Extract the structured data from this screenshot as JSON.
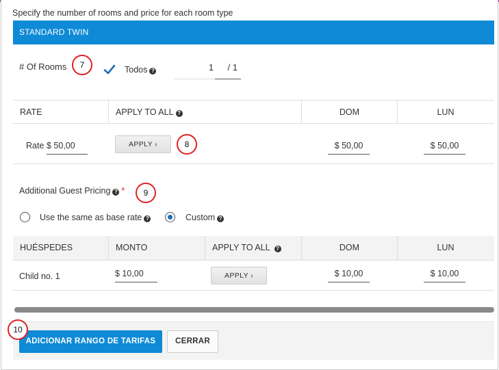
{
  "instructions": "Specify the number of rooms and price for each room type",
  "room_type": {
    "name": "STANDARD TWIN"
  },
  "rooms": {
    "label": "# Of Rooms",
    "todos_label": "Todos",
    "todos_checked": true,
    "value": "1",
    "total": "/ 1"
  },
  "rate_table": {
    "headers": [
      "RATE",
      "APPLY TO ALL",
      "DOM",
      "LUN"
    ],
    "row": {
      "label": "Rate",
      "value": "$ 50,00",
      "apply_label": "APPLY",
      "dom": "$ 50,00",
      "lun": "$ 50,00"
    }
  },
  "additional_guest": {
    "label": "Additional Guest Pricing",
    "required_mark": "*",
    "options": [
      {
        "label": "Use the same as base rate",
        "selected": false
      },
      {
        "label": "Custom",
        "selected": true
      }
    ]
  },
  "guest_table": {
    "headers": [
      "HUÉSPEDES",
      "MONTO",
      "APPLY TO ALL",
      "DOM",
      "LUN"
    ],
    "rows": [
      {
        "guest": "Child no. 1",
        "monto": "$ 10,00",
        "apply_label": "APPLY",
        "dom": "$ 10,00",
        "lun": "$ 10,00"
      }
    ]
  },
  "footer": {
    "primary_label": "ADICIONAR RANGO DE TARIFAS",
    "secondary_label": "CERRAR"
  },
  "annotations": [
    "7",
    "8",
    "9",
    "10"
  ],
  "icons": {
    "help": "?",
    "chevron": "›"
  },
  "colors": {
    "accent": "#0e8ad6",
    "annotation": "#e02020"
  }
}
